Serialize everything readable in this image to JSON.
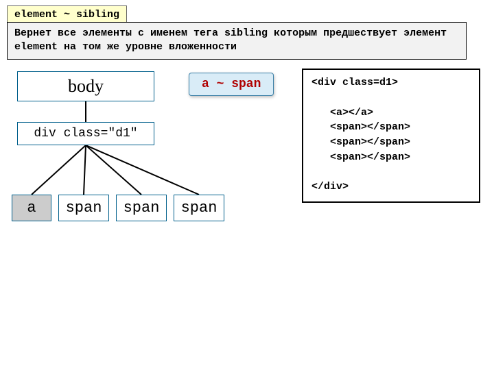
{
  "title": "element ~ sibling",
  "description": "Вернет все  элементы с именем тега sibling которым предшествует элемент element на том же уровне вложенности",
  "example_selector": "a ~ span",
  "tree": {
    "body": "body",
    "div": "div class=\"d1\"",
    "a": "a",
    "span1": "span",
    "span2": "span",
    "span3": "span"
  },
  "code": "<div class=d1>\n\n   <a></a>\n   <span></span>\n   <span></span>\n   <span></span>\n\n</div>"
}
